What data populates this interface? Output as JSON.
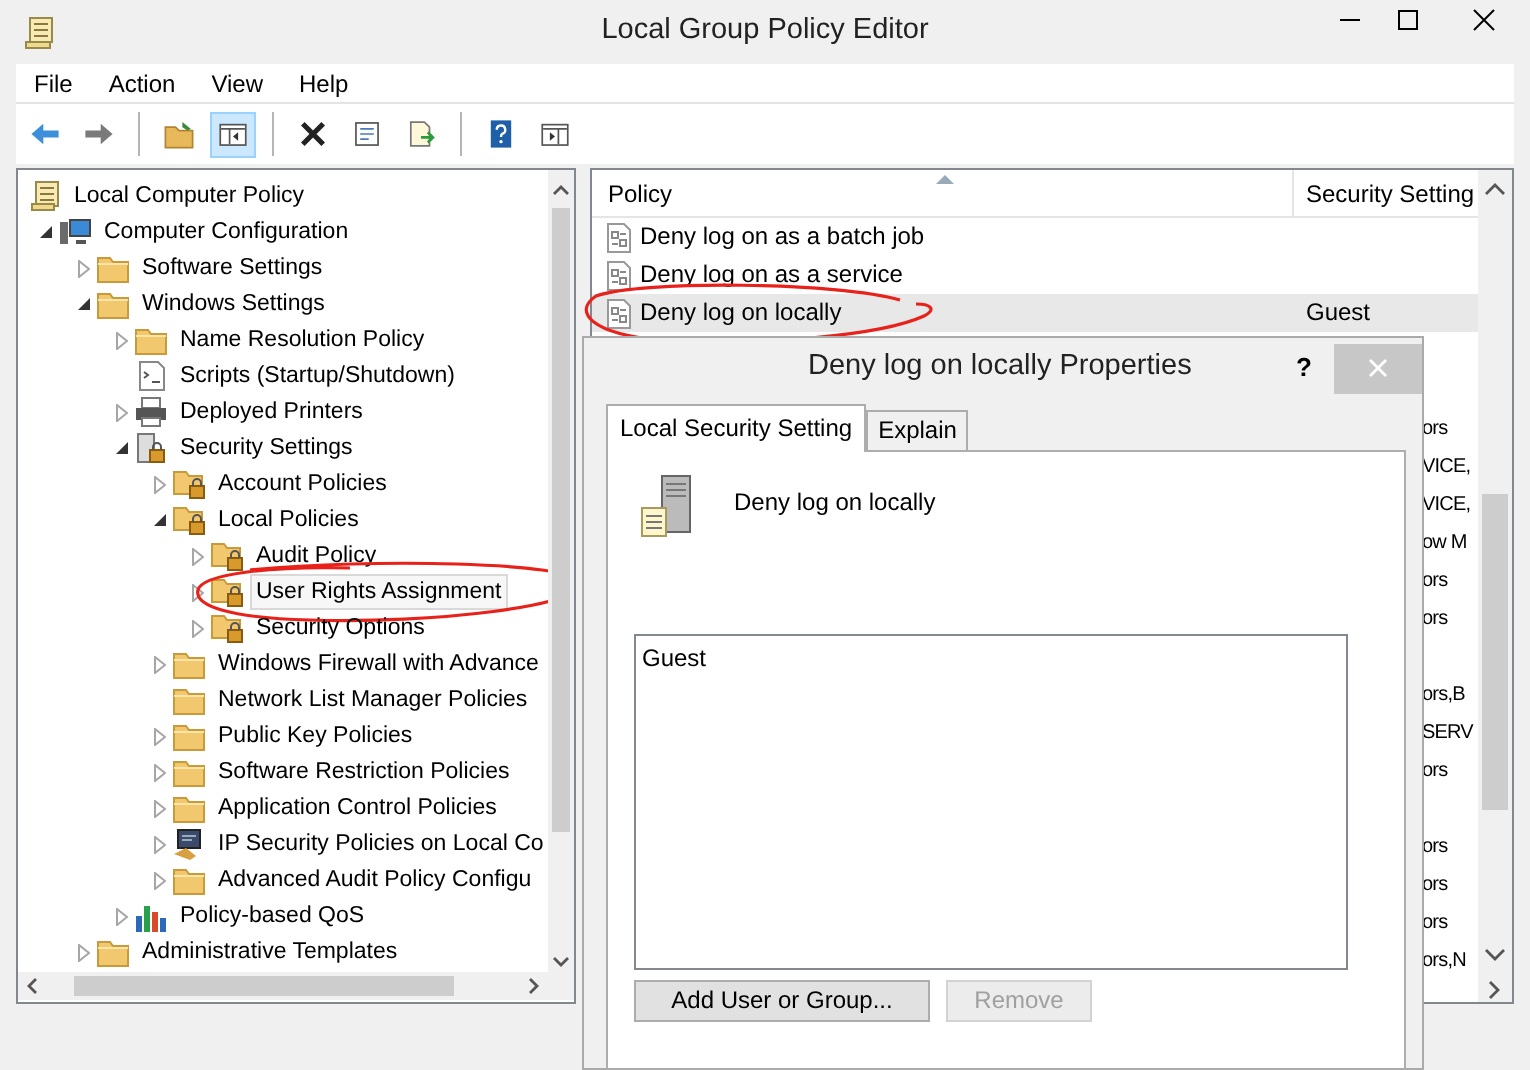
{
  "window": {
    "title": "Local Group Policy Editor"
  },
  "menu": [
    "File",
    "Action",
    "View",
    "Help"
  ],
  "toolbar": [
    {
      "kind": "back"
    },
    {
      "kind": "forward"
    },
    {
      "kind": "sep"
    },
    {
      "kind": "up"
    },
    {
      "kind": "pane",
      "selected": true
    },
    {
      "kind": "sep"
    },
    {
      "kind": "delete"
    },
    {
      "kind": "properties"
    },
    {
      "kind": "export"
    },
    {
      "kind": "sep"
    },
    {
      "kind": "help"
    },
    {
      "kind": "view"
    }
  ],
  "tree": [
    {
      "label": "Local Computer Policy",
      "kind": "scroll",
      "children": [
        {
          "label": "Computer Configuration",
          "kind": "computer",
          "expanded": true,
          "children": [
            {
              "label": "Software Settings",
              "kind": "folder",
              "expanded": false
            },
            {
              "label": "Windows Settings",
              "kind": "folder",
              "expanded": true,
              "children": [
                {
                  "label": "Name Resolution Policy",
                  "kind": "folder",
                  "expanded": false
                },
                {
                  "label": "Scripts (Startup/Shutdown)",
                  "kind": "script"
                },
                {
                  "label": "Deployed Printers",
                  "kind": "printer",
                  "expanded": false
                },
                {
                  "label": "Security Settings",
                  "kind": "secure",
                  "expanded": true,
                  "children": [
                    {
                      "label": "Account Policies",
                      "kind": "lockfolder",
                      "expanded": false
                    },
                    {
                      "label": "Local Policies",
                      "kind": "lockfolder",
                      "expanded": true,
                      "children": [
                        {
                          "label": "Audit Policy",
                          "kind": "lockfolder",
                          "expanded": false
                        },
                        {
                          "label": "User Rights Assignment",
                          "kind": "lockfolder",
                          "expanded": false,
                          "selected": true,
                          "circled": true
                        },
                        {
                          "label": "Security Options",
                          "kind": "lockfolder",
                          "expanded": false
                        }
                      ]
                    },
                    {
                      "label": "Windows Firewall with Advance",
                      "kind": "folder",
                      "expanded": false
                    },
                    {
                      "label": "Network List Manager Policies",
                      "kind": "folder"
                    },
                    {
                      "label": "Public Key Policies",
                      "kind": "folder",
                      "expanded": false
                    },
                    {
                      "label": "Software Restriction Policies",
                      "kind": "folder",
                      "expanded": false
                    },
                    {
                      "label": "Application Control Policies",
                      "kind": "folder",
                      "expanded": false
                    },
                    {
                      "label": "IP Security Policies on Local Co",
                      "kind": "ipsec",
                      "expanded": false
                    },
                    {
                      "label": "Advanced Audit Policy Configu",
                      "kind": "folder",
                      "expanded": false
                    }
                  ]
                },
                {
                  "label": "Policy-based QoS",
                  "kind": "chart",
                  "expanded": false
                }
              ]
            },
            {
              "label": "Administrative Templates",
              "kind": "folder",
              "expanded": false
            }
          ]
        }
      ]
    }
  ],
  "table": {
    "columns": [
      "Policy",
      "Security Setting"
    ],
    "rows": [
      {
        "policy": "Deny log on as a batch job",
        "selected": false
      },
      {
        "policy": "Deny log on as a service",
        "selected": false
      },
      {
        "policy": "Deny log on locally",
        "setting": "Guest",
        "selected": true,
        "circled": true
      },
      {},
      {},
      {
        "setting": "ors"
      },
      {
        "setting": "VICE,"
      },
      {
        "setting": "VICE,"
      },
      {
        "setting": "ow M"
      },
      {
        "setting": "ors"
      },
      {
        "setting": "ors"
      },
      {},
      {
        "setting": "ors,B"
      },
      {
        "setting": "SERV"
      },
      {
        "setting": "ors"
      },
      {},
      {
        "setting": "ors"
      },
      {
        "setting": "ors"
      },
      {
        "setting": "ors"
      },
      {
        "setting": "ors,N"
      }
    ]
  },
  "dialog": {
    "title": "Deny log on locally Properties",
    "help": "?",
    "tabs": [
      {
        "label": "Local Security Setting",
        "selected": true
      },
      {
        "label": "Explain",
        "selected": false
      }
    ],
    "heading": "Deny log on locally",
    "members": [
      "Guest"
    ],
    "buttons": [
      {
        "label": "Add User or Group...",
        "disabled": false
      },
      {
        "label": "Remove",
        "disabled": true
      }
    ]
  }
}
